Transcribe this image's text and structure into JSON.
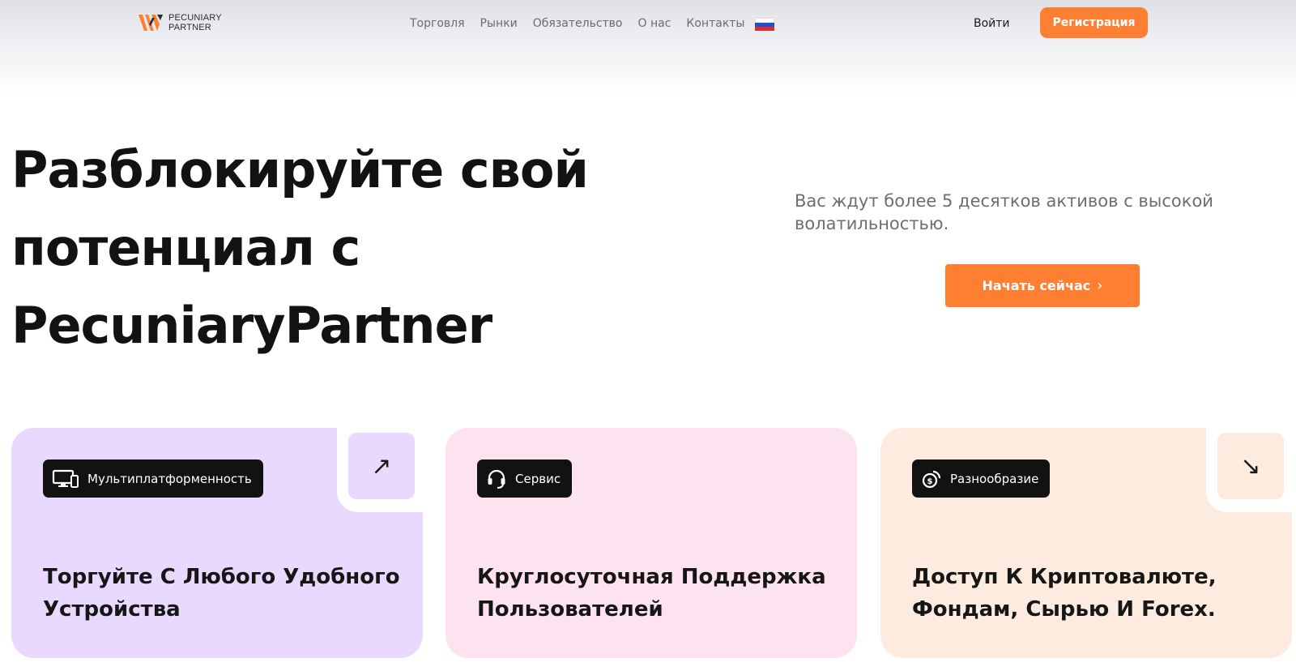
{
  "header": {
    "logo": {
      "line1": "PECUNIARY",
      "line2": "PARTNER"
    },
    "nav": [
      "Торговля",
      "Рынки",
      "Обязательство",
      "О нас",
      "Контакты"
    ],
    "language_flag": "russia-flag",
    "login_label": "Войти",
    "register_label": "Регистрация"
  },
  "hero": {
    "title": "Разблокируйте свой потенциал с PecuniaryPartner",
    "subtitle": "Вас ждут более 5 десятков активов с высокой волатильностью.",
    "cta_label": "Начать сейчас"
  },
  "cards": [
    {
      "badge": "Мультиплатформенность",
      "badge_icon": "devices-icon",
      "title": "Торгуйте С Любого Удобного Устройства",
      "arrow": "↗",
      "bg": "#ead9fe"
    },
    {
      "badge": "Сервис",
      "badge_icon": "headset-icon",
      "title": "Круглосуточная Поддержка Пользователей",
      "bg": "#fde2f0"
    },
    {
      "badge": "Разнообразие",
      "badge_icon": "coins-icon",
      "title": "Доступ К Криптовалюте, Фондам, Сырью И Forex.",
      "arrow": "↘",
      "bg": "#fdebe0"
    }
  ],
  "colors": {
    "accent": "#ff7f32",
    "dark": "#121212"
  }
}
